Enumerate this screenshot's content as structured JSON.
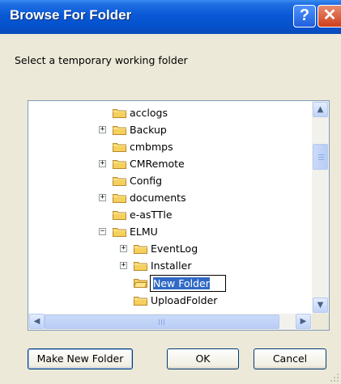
{
  "window": {
    "title": "Browse For Folder",
    "help_glyph": "?",
    "close_glyph": "✕"
  },
  "prompt": "Select a temporary working folder",
  "tree": {
    "items": [
      {
        "label": "acclogs",
        "expander": ""
      },
      {
        "label": "Backup",
        "expander": "+"
      },
      {
        "label": "cmbmps",
        "expander": ""
      },
      {
        "label": "CMRemote",
        "expander": "+"
      },
      {
        "label": "Config",
        "expander": ""
      },
      {
        "label": "documents",
        "expander": "+"
      },
      {
        "label": "e-asTTle",
        "expander": ""
      },
      {
        "label": "ELMU",
        "expander": "−"
      },
      {
        "label": "EventLog",
        "expander": "+"
      },
      {
        "label": "Installer",
        "expander": "+"
      },
      {
        "label": "New Folder",
        "expander": "",
        "editing": true
      },
      {
        "label": "UploadFolder",
        "expander": ""
      }
    ]
  },
  "scroll": {
    "up": "▲",
    "down": "▼",
    "left": "◀",
    "right": "▶"
  },
  "buttons": {
    "make_new_folder": "Make New Folder",
    "ok": "OK",
    "cancel": "Cancel"
  },
  "colors": {
    "titlebar": "#0a58d6",
    "selection": "#316ac5",
    "folder": "#f5d05c",
    "dialog": "#ece9d8"
  }
}
